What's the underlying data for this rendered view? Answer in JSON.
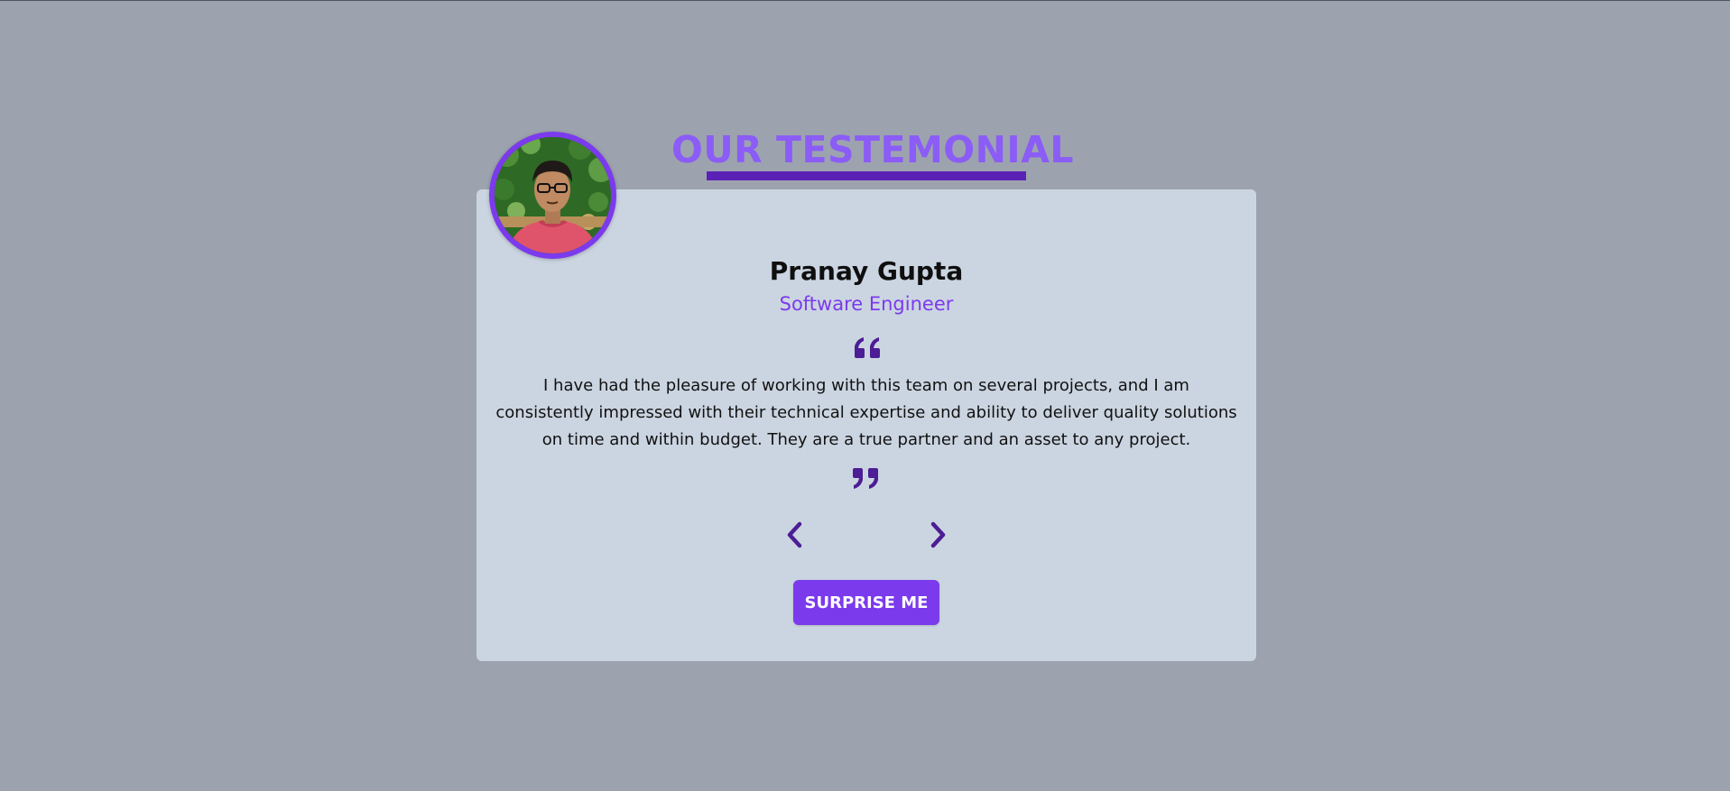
{
  "header": {
    "title": "OUR TESTEMONIAL"
  },
  "testimonial": {
    "name": "Pranay Gupta",
    "job": "Software Engineer",
    "text": "I have had the pleasure of working with this team on several projects, and I am consistently impressed with their technical expertise and ability to deliver quality solutions on time and within budget. They are a true partner and an asset to any project."
  },
  "controls": {
    "surprise_label": "SURPRISE ME"
  },
  "icons": {
    "quote_open": "quote-left-icon",
    "quote_close": "quote-right-icon",
    "prev": "chevron-left-icon",
    "next": "chevron-right-icon"
  },
  "colors": {
    "background": "#9ca3af",
    "card": "#cbd5e1",
    "accent": "#7c3aed",
    "heading": "#8b5cf6",
    "dark_accent": "#5b21b6",
    "icon": "#4c1d95"
  }
}
